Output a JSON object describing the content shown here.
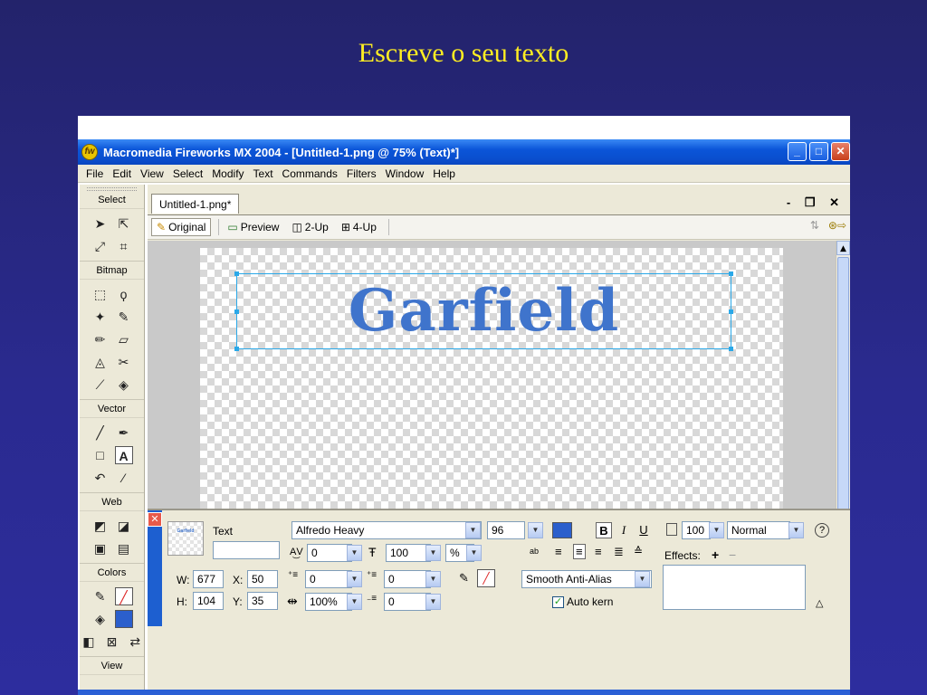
{
  "slide": {
    "title": "Escreve o seu texto"
  },
  "window": {
    "title": "Macromedia Fireworks MX 2004 - [Untitled-1.png @  75% (Text)*]",
    "controls": [
      "_",
      "□",
      "✕"
    ]
  },
  "menubar": [
    "File",
    "Edit",
    "View",
    "Select",
    "Modify",
    "Text",
    "Commands",
    "Filters",
    "Window",
    "Help"
  ],
  "toolbox": {
    "sections": [
      "Select",
      "Bitmap",
      "Vector",
      "Web",
      "Colors",
      "View"
    ]
  },
  "document": {
    "tab": "Untitled-1.png*",
    "doc_controls": "- ❐ ✕",
    "views": [
      "Original",
      "Preview",
      "2-Up",
      "4-Up"
    ],
    "active_view": "Original",
    "canvas_text": "Garfield",
    "text_color": "#3f74cc"
  },
  "properties": {
    "object_type": "Text",
    "object_name": "",
    "thumb_text": "Garfield",
    "font": "Alfredo Heavy",
    "size": "96",
    "fill_color": "#2b5fcc",
    "bold": "B",
    "italic": "I",
    "underline": "U",
    "kerning": "0",
    "leading": "100",
    "leading_unit": "%",
    "indent": "0",
    "space_before": "0",
    "space_after": "0",
    "baseline": "0",
    "horizontal_scale": "100%",
    "anti_alias": "Smooth Anti-Alias",
    "auto_kern_label": "Auto kern",
    "auto_kern_checked": true,
    "opacity": "100",
    "blend_mode": "Normal",
    "effects_label": "Effects:",
    "w_label": "W:",
    "w": "677",
    "h_label": "H:",
    "h": "104",
    "x_label": "X:",
    "x": "50",
    "y_label": "Y:",
    "y": "35"
  }
}
